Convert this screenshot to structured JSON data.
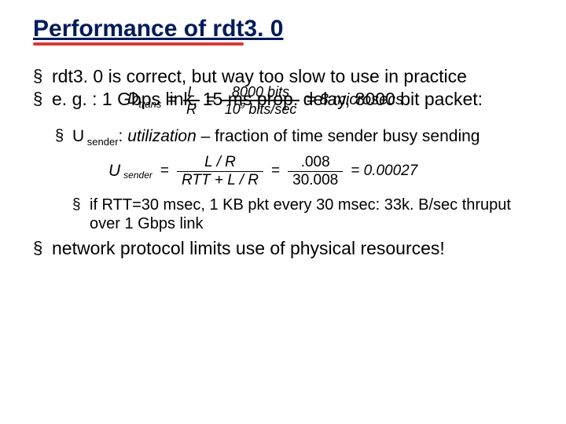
{
  "title": "Performance of rdt3. 0",
  "bullets": {
    "b1": "rdt3. 0 is correct, but way too slow to use in practice",
    "b2": "e. g. : 1 Gbps link, 15 ms prop. delay, 8000 bit packet:",
    "b3": "network protocol limits use of physical resources!"
  },
  "formula1": {
    "Dlabel": "D",
    "Dsub": "trans",
    "eq": "=",
    "frac1_num": "L",
    "frac1_den": "R",
    "frac2_num": "8000 bits",
    "frac2_den_a": "10",
    "frac2_den_sup": "9",
    "frac2_den_b": " bits/sec",
    "rhs": "= 8 microsecs"
  },
  "sub": {
    "u_label_U": "U",
    "u_label_sub": " sender",
    "u_text_a": ": ",
    "u_text_ital": "utilization",
    "u_text_b": " – fraction of time sender busy sending"
  },
  "formula2": {
    "U": "U",
    "Usub": "sender",
    "eq": "=",
    "f1_num": "L / R",
    "f1_den": "RTT + L / R",
    "f2_num": ".008",
    "f2_den": "30.008",
    "result": "= 0.00027"
  },
  "subsub": {
    "s1": "if RTT=30 msec, 1 KB pkt every 30 msec: 33k. B/sec thruput over 1 Gbps link"
  }
}
